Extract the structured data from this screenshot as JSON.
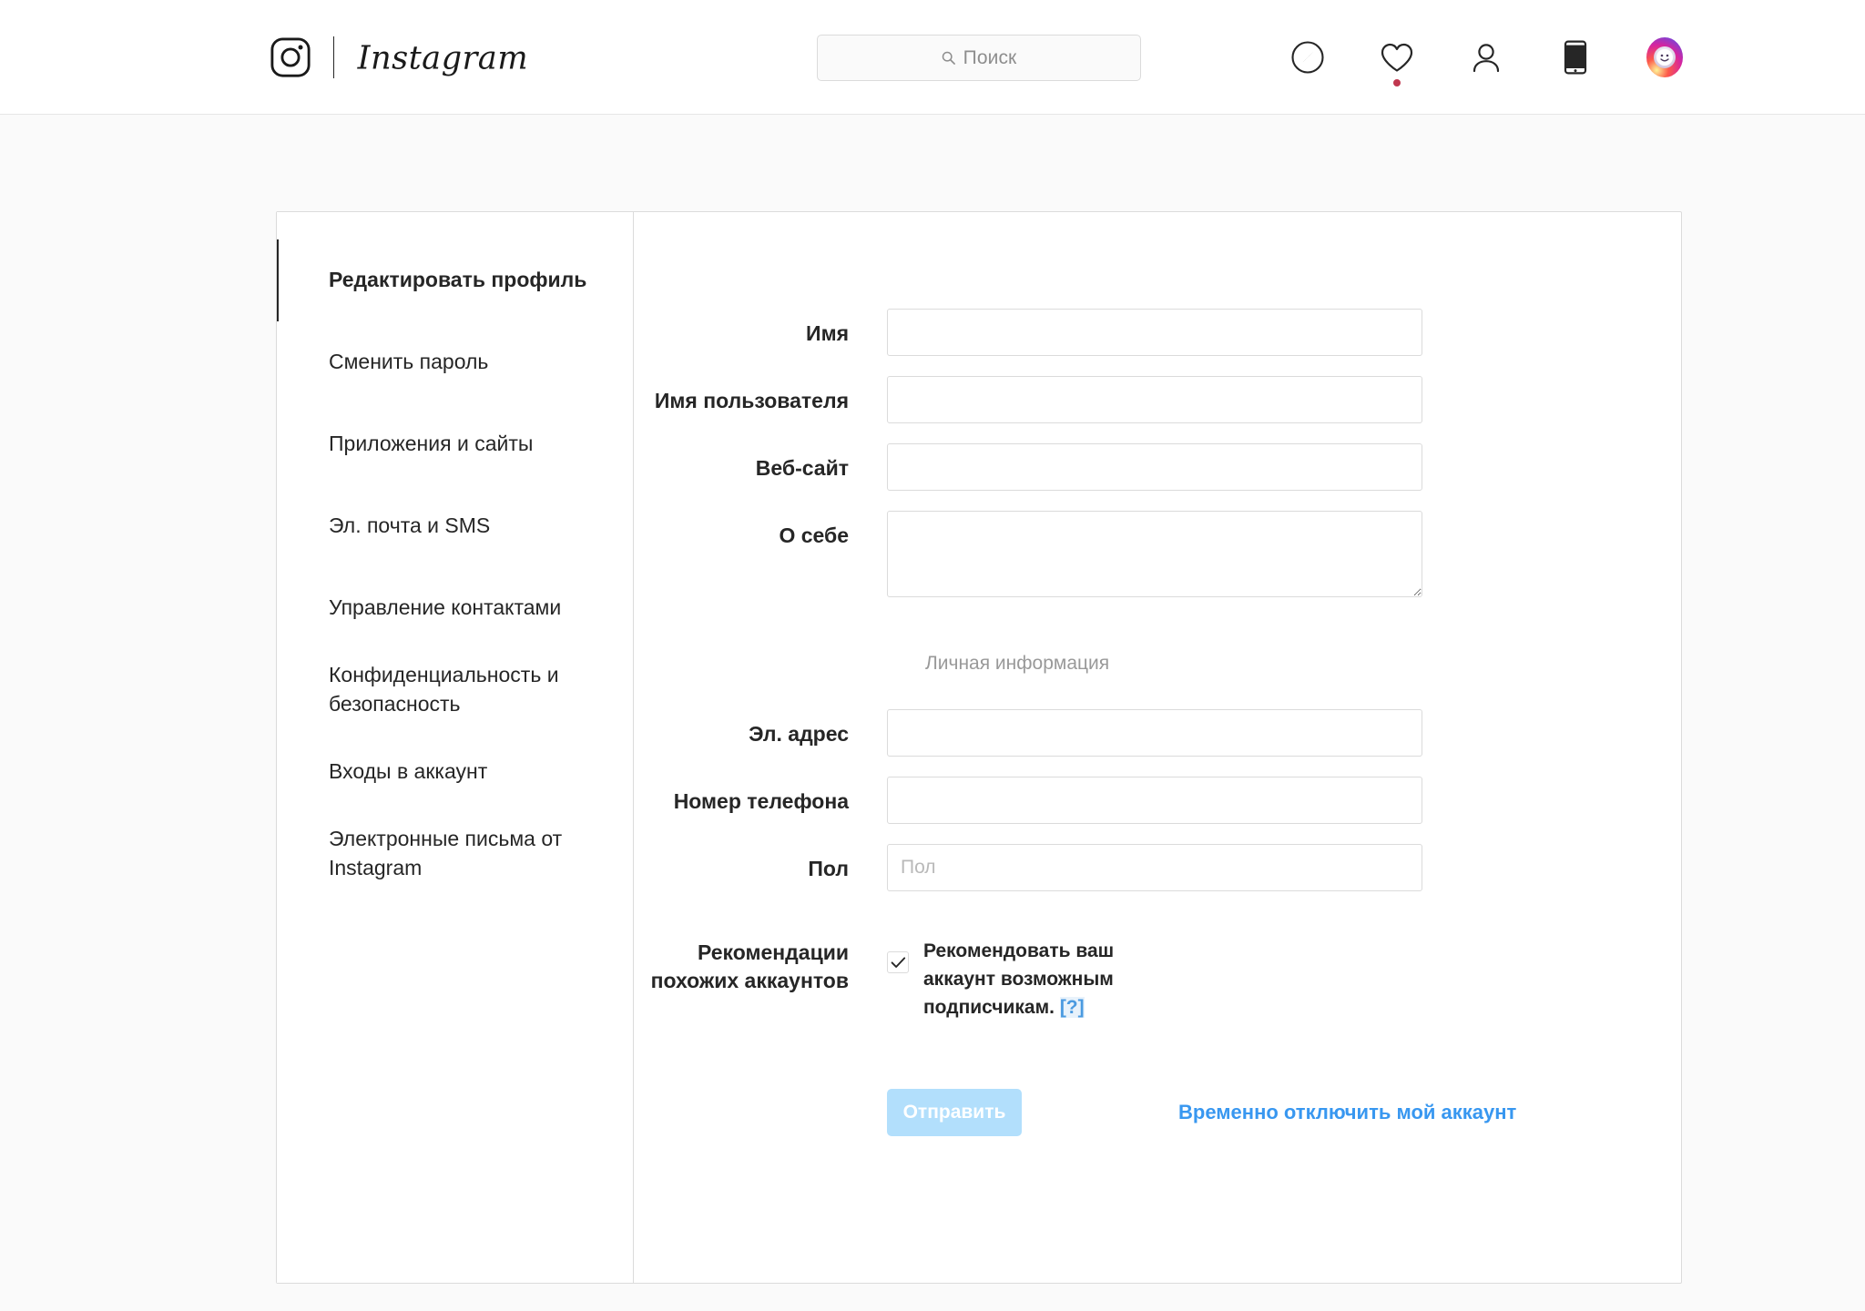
{
  "header": {
    "brand_name": "Instagram",
    "brand_icon": "instagram-camera-icon",
    "search": {
      "placeholder": "Поиск",
      "value": "",
      "icon": "search-icon"
    },
    "nav": [
      {
        "name": "explore",
        "icon": "compass-icon",
        "has_notification": false
      },
      {
        "name": "activity",
        "icon": "heart-icon",
        "has_notification": true
      },
      {
        "name": "profile",
        "icon": "person-icon",
        "has_notification": false
      },
      {
        "name": "mobile-app",
        "icon": "phone-icon",
        "has_notification": false
      }
    ],
    "avatar": {
      "name": "user-avatar",
      "icon": "avatar-image"
    }
  },
  "sidebar": {
    "items": [
      {
        "label": "Редактировать профиль",
        "active": true
      },
      {
        "label": "Сменить пароль",
        "active": false
      },
      {
        "label": "Приложения и сайты",
        "active": false
      },
      {
        "label": "Эл. почта и SMS",
        "active": false
      },
      {
        "label": "Управление контактами",
        "active": false
      },
      {
        "label": "Конфиденциальность и безопасность",
        "active": false
      },
      {
        "label": "Входы в аккаунт",
        "active": false
      },
      {
        "label": "Электронные письма от Instagram",
        "active": false
      }
    ]
  },
  "form": {
    "fields": {
      "name": {
        "label": "Имя",
        "value": "",
        "placeholder": ""
      },
      "username": {
        "label": "Имя пользователя",
        "value": "",
        "placeholder": ""
      },
      "website": {
        "label": "Веб-сайт",
        "value": "",
        "placeholder": ""
      },
      "bio": {
        "label": "О себе",
        "value": "",
        "placeholder": ""
      },
      "email": {
        "label": "Эл. адрес",
        "value": "",
        "placeholder": ""
      },
      "phone": {
        "label": "Номер телефона",
        "value": "",
        "placeholder": ""
      },
      "gender": {
        "label": "Пол",
        "value": "",
        "placeholder": "Пол"
      }
    },
    "personal_info_heading": "Личная информация",
    "suggestions": {
      "label": "Рекомендации похожих аккаунтов",
      "checkbox_text": "Рекомендовать ваш аккаунт возможным подписчикам.",
      "help_label": "[?]",
      "checked": true
    },
    "submit_label": "Отправить",
    "disable_account_label": "Временно отключить мой аккаунт"
  },
  "colors": {
    "accent_blue": "#3897f0",
    "submit_disabled": "#b2dffc",
    "notification_dot": "#c0374f",
    "page_background": "#fafafa",
    "border": "#dbdbdb",
    "text_primary": "#262626",
    "text_muted": "#999999"
  }
}
